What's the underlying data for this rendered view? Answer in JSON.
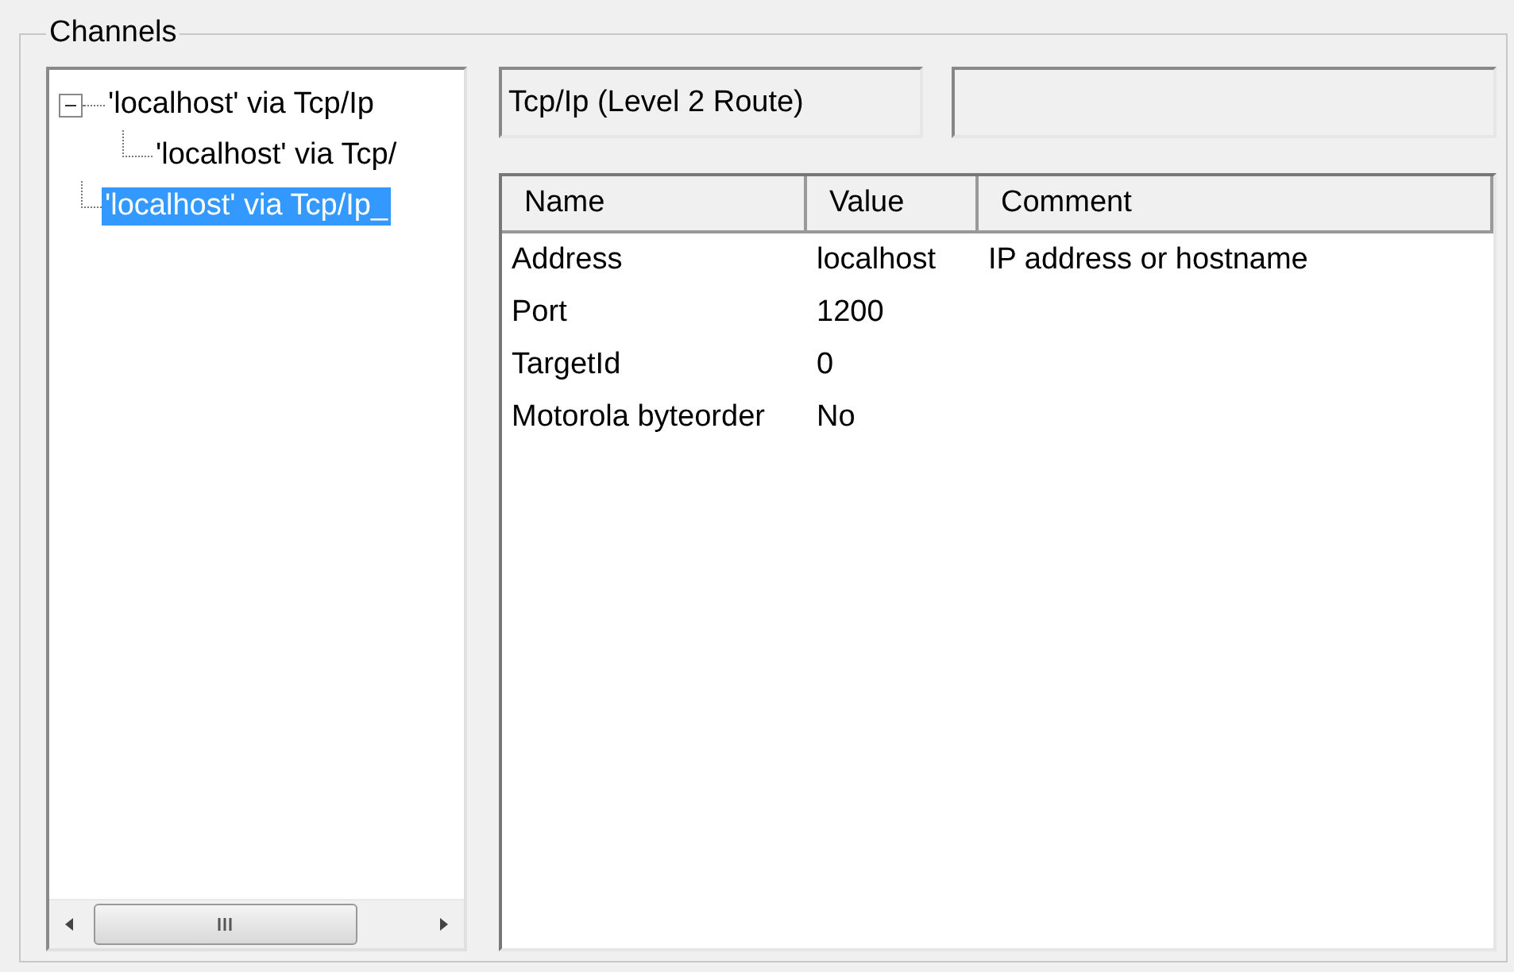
{
  "group": {
    "title": "Channels"
  },
  "tree": [
    {
      "label": "'localhost' via Tcp/Ip",
      "selected": false,
      "expanded": true,
      "children": [
        {
          "label": "'localhost' via Tcp/",
          "selected": false
        }
      ]
    },
    {
      "label": "'localhost' via Tcp/Ip_",
      "selected": true
    }
  ],
  "fields": [
    {
      "value": "Tcp/Ip (Level 2 Route)"
    }
  ],
  "table": {
    "columns": [
      "Name",
      "Value",
      "Comment"
    ],
    "rows": [
      [
        "Address",
        "localhost",
        "IP address or hostname"
      ],
      [
        "Port",
        "1200",
        ""
      ],
      [
        "TargetId",
        "0",
        ""
      ],
      [
        "Motorola byteorder",
        "No",
        ""
      ]
    ]
  }
}
